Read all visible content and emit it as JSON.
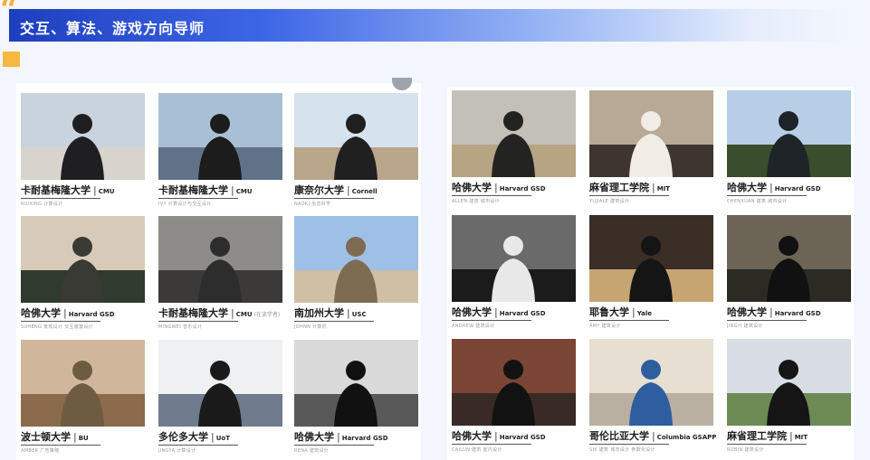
{
  "header": {
    "title": "交互、算法、游戏方向导师"
  },
  "colors": {
    "accent_blue": "#2a4fd0",
    "accent_orange": "#f6b843",
    "background": "#f3f6fd"
  },
  "left_panel": {
    "cards": [
      {
        "school": "卡耐基梅隆大学",
        "abbr": "CMU",
        "extra": "",
        "subtext": "RUIXING 计算设计"
      },
      {
        "school": "卡耐基梅隆大学",
        "abbr": "CMU",
        "extra": "",
        "subtext": "IVY 计算设计与交互设计"
      },
      {
        "school": "康奈尔大学",
        "abbr": "Cornell",
        "extra": "",
        "subtext": "NAOKI 信息科学"
      },
      {
        "school": "哈佛大学",
        "abbr": "Harvard GSD",
        "extra": "",
        "subtext": "SUHENG 景观设计 交互装置设计"
      },
      {
        "school": "卡耐基梅隆大学",
        "abbr": "CMU",
        "extra": "(在读学者)",
        "subtext": "MINGWEI 音乐设计"
      },
      {
        "school": "南加州大学",
        "abbr": "USC",
        "extra": "",
        "subtext": "JOHNN 计算机"
      },
      {
        "school": "波士顿大学",
        "abbr": "BU",
        "extra": "",
        "subtext": "AMBER 广告策略"
      },
      {
        "school": "多伦多大学",
        "abbr": "UoT",
        "extra": "",
        "subtext": "JINGYA 计算设计"
      },
      {
        "school": "哈佛大学",
        "abbr": "Harvard GSD",
        "extra": "",
        "subtext": "RENA 建筑设计"
      }
    ]
  },
  "right_panel": {
    "cards": [
      {
        "school": "哈佛大学",
        "abbr": "Harvard GSD",
        "extra": "",
        "subtext": "ALLEN 建筑 城市设计"
      },
      {
        "school": "麻省理工学院",
        "abbr": "MIT",
        "extra": "",
        "subtext": "YUJIALE 建筑设计"
      },
      {
        "school": "哈佛大学",
        "abbr": "Harvard GSD",
        "extra": "",
        "subtext": "CHENXUAN 建筑 城市设计"
      },
      {
        "school": "哈佛大学",
        "abbr": "Harvard GSD",
        "extra": "",
        "subtext": "ANDREW 建筑设计"
      },
      {
        "school": "耶鲁大学",
        "abbr": "Yale",
        "extra": "",
        "subtext": "AMY 建筑设计"
      },
      {
        "school": "哈佛大学",
        "abbr": "Harvard GSD",
        "extra": "",
        "subtext": "JINGYI 建筑设计"
      },
      {
        "school": "哈佛大学",
        "abbr": "Harvard GSD",
        "extra": "",
        "subtext": "CAILUN 建筑 室内设计"
      },
      {
        "school": "哥伦比亚大学",
        "abbr": "Columbia GSAPP",
        "extra": "",
        "subtext": "SIK 建筑 城市设计 参数化设计"
      },
      {
        "school": "麻省理工学院",
        "abbr": "MIT",
        "extra": "",
        "subtext": "ROBIN 建筑设计"
      }
    ]
  },
  "photos": [
    {
      "name": "street-photo",
      "sky": "#c9d3dd",
      "ground": "#d8d4cc",
      "figure": "#1f1f22"
    },
    {
      "name": "harbor-photo",
      "sky": "#a9bfd6",
      "ground": "#5f7288",
      "figure": "#1c1c1c"
    },
    {
      "name": "beach-photo",
      "sky": "#d6e3ee",
      "ground": "#b9a68b",
      "figure": "#202020"
    },
    {
      "name": "portrait-photo",
      "sky": "#d7cab8",
      "ground": "#2f3b2c",
      "figure": "#3a3a34"
    },
    {
      "name": "room-photo",
      "sky": "#8e8c88",
      "ground": "#3b3a39",
      "figure": "#2d2d2d"
    },
    {
      "name": "sky-photo",
      "sky": "#9fc0e6",
      "ground": "#cfc0a5",
      "figure": "#7d6b52"
    },
    {
      "name": "cliff-photo",
      "sky": "#d0b79b",
      "ground": "#8b6b4c",
      "figure": "#6e5c42"
    },
    {
      "name": "whiteboard-photo",
      "sky": "#eef0f2",
      "ground": "#6e7c8e",
      "figure": "#1a1a1a"
    },
    {
      "name": "bw-sea-photo",
      "sky": "#d9d9d9",
      "ground": "#595959",
      "figure": "#111111"
    },
    {
      "name": "desert-photo",
      "sky": "#c3c0b8",
      "ground": "#b6a483",
      "figure": "#232321"
    },
    {
      "name": "window-photo",
      "sky": "#b8a896",
      "ground": "#3e3530",
      "figure": "#f1ede6"
    },
    {
      "name": "garden-photo",
      "sky": "#b7cee6",
      "ground": "#3a4d2c",
      "figure": "#1f2428"
    },
    {
      "name": "bw-shadow-photo",
      "sky": "#6a6a6a",
      "ground": "#1b1b1b",
      "figure": "#e8e8e8"
    },
    {
      "name": "night-street-photo",
      "sky": "#3a2e26",
      "ground": "#c7a572",
      "figure": "#151515"
    },
    {
      "name": "sunset-photo",
      "sky": "#6c6454",
      "ground": "#2b2a23",
      "figure": "#111111"
    },
    {
      "name": "brick-wall-photo",
      "sky": "#7a4535",
      "ground": "#3a2a25",
      "figure": "#121212"
    },
    {
      "name": "arch-photo",
      "sky": "#e7dfd2",
      "ground": "#b9b0a2",
      "figure": "#2f5e9e"
    },
    {
      "name": "campus-photo",
      "sky": "#d7dde3",
      "ground": "#6d8a55",
      "figure": "#151515"
    }
  ]
}
